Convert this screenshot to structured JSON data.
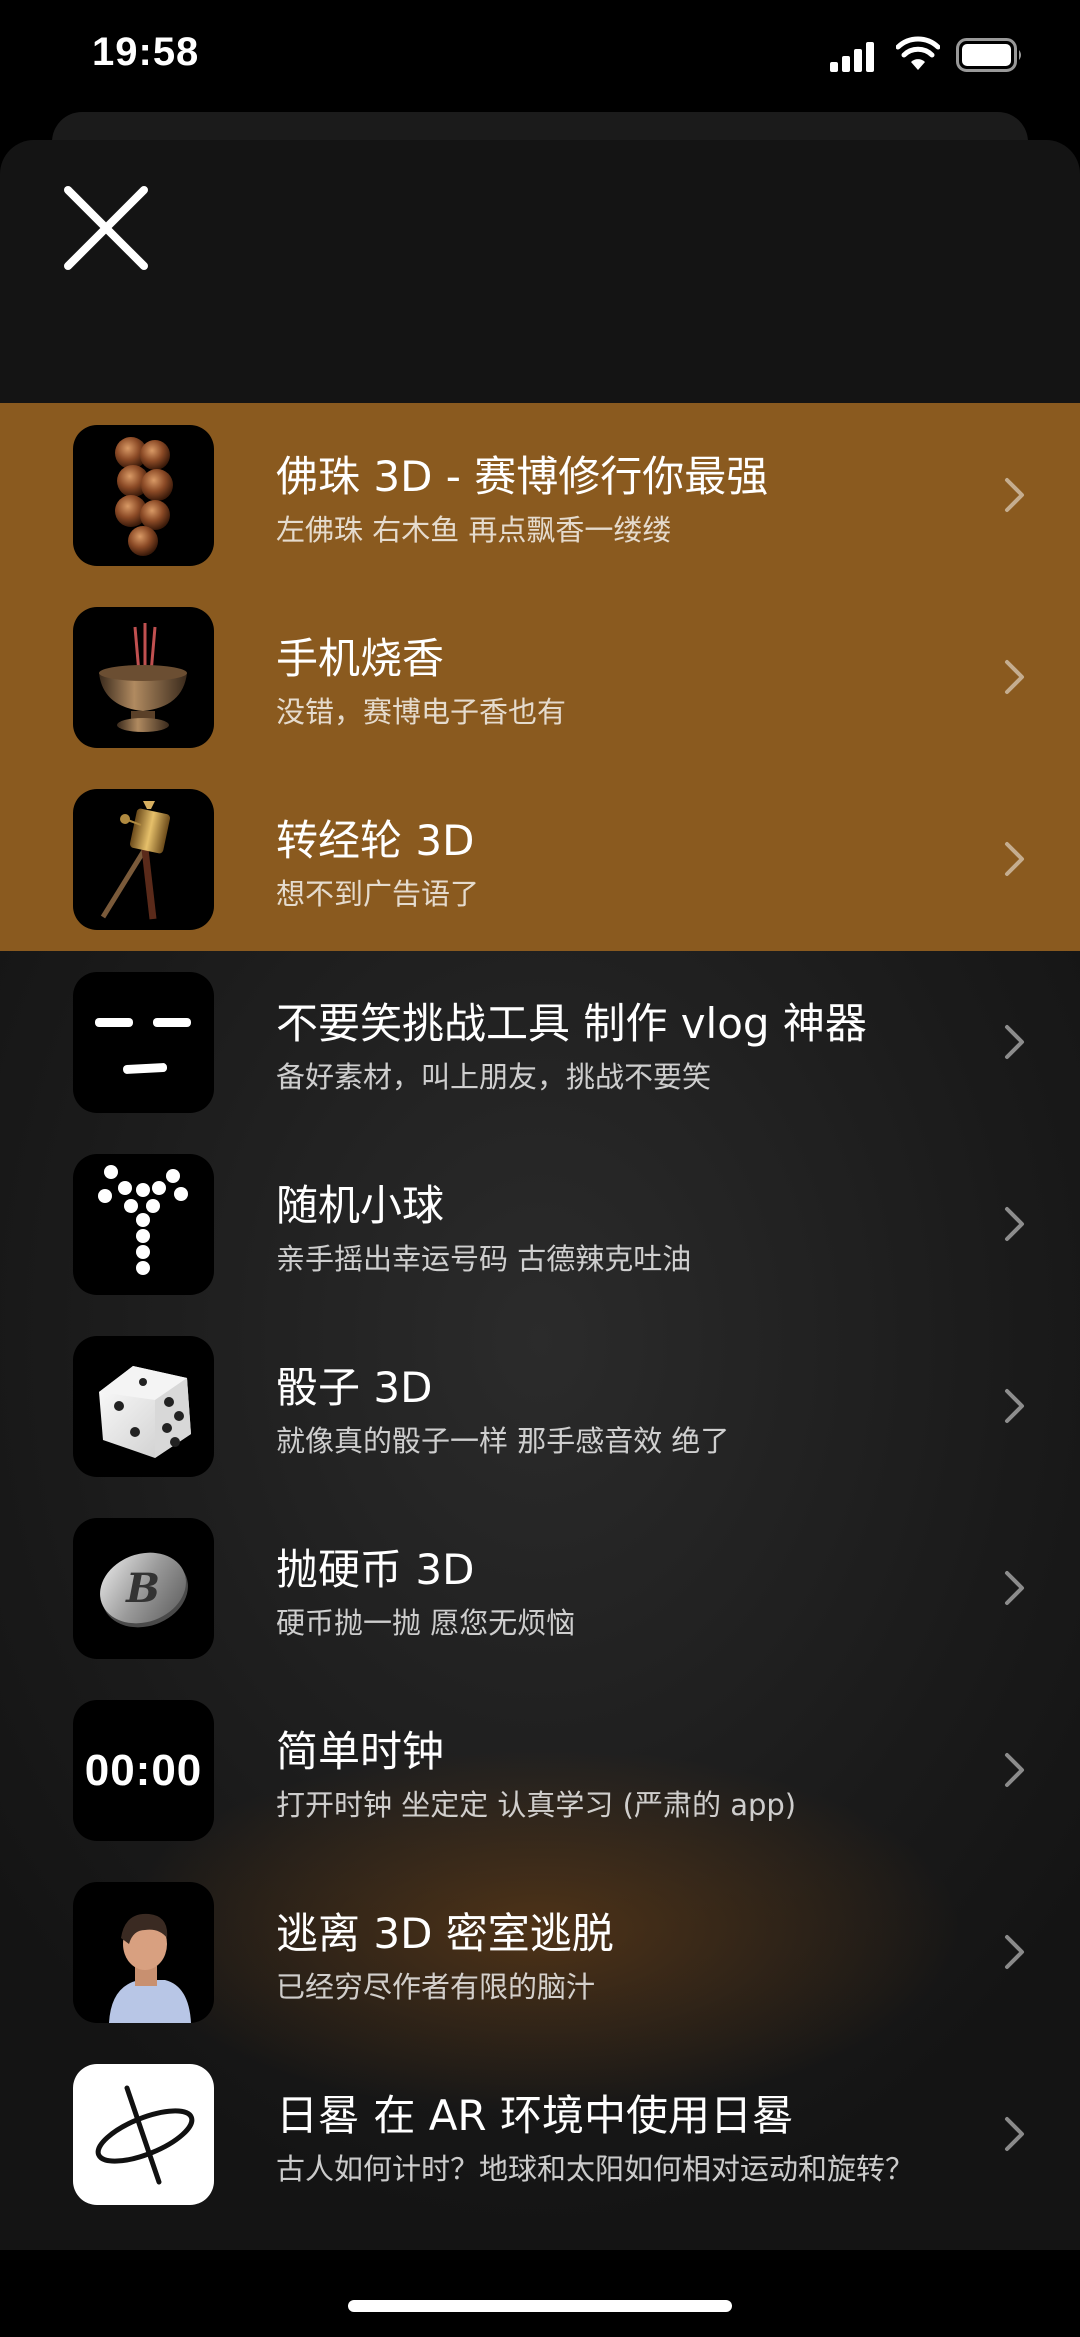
{
  "status_bar": {
    "time": "19:58"
  },
  "items": [
    {
      "title": "佛珠 3D - 赛博修行你最强",
      "subtitle": "左佛珠 右木鱼 再点飘香一缕缕",
      "icon": "prayer-beads-icon",
      "highlighted": true
    },
    {
      "title": "手机烧香",
      "subtitle": "没错，赛博电子香也有",
      "icon": "incense-burner-icon",
      "highlighted": true
    },
    {
      "title": "转经轮 3D",
      "subtitle": "想不到广告语了",
      "icon": "prayer-wheel-icon",
      "highlighted": true
    },
    {
      "title": "不要笑挑战工具 制作 vlog 神器",
      "subtitle": "备好素材，叫上朋友，挑战不要笑",
      "icon": "straight-face-icon",
      "highlighted": false
    },
    {
      "title": "随机小球",
      "subtitle": "亲手摇出幸运号码 古德辣克吐油",
      "icon": "random-balls-icon",
      "highlighted": false
    },
    {
      "title": "骰子 3D",
      "subtitle": "就像真的骰子一样 那手感音效 绝了",
      "icon": "dice-icon",
      "highlighted": false
    },
    {
      "title": "抛硬币 3D",
      "subtitle": "硬币抛一抛 愿您无烦恼",
      "icon": "coin-icon",
      "highlighted": false
    },
    {
      "title": "简单时钟",
      "subtitle": "打开时钟 坐定定 认真学习 (严肃的 app)",
      "icon": "clock-icon",
      "icon_text": "00:00",
      "highlighted": false
    },
    {
      "title": "逃离 3D 密室逃脱",
      "subtitle": "已经穷尽作者有限的脑汁",
      "icon": "escape-room-icon",
      "highlighted": false
    },
    {
      "title": "日晷 在 AR 环境中使用日晷",
      "subtitle": "古人如何计时？地球和太阳如何相对运动和旋转？",
      "icon": "sundial-icon",
      "highlighted": false
    }
  ],
  "colors": {
    "highlight": "#8a5a1f",
    "background": "#1e1e1e"
  }
}
